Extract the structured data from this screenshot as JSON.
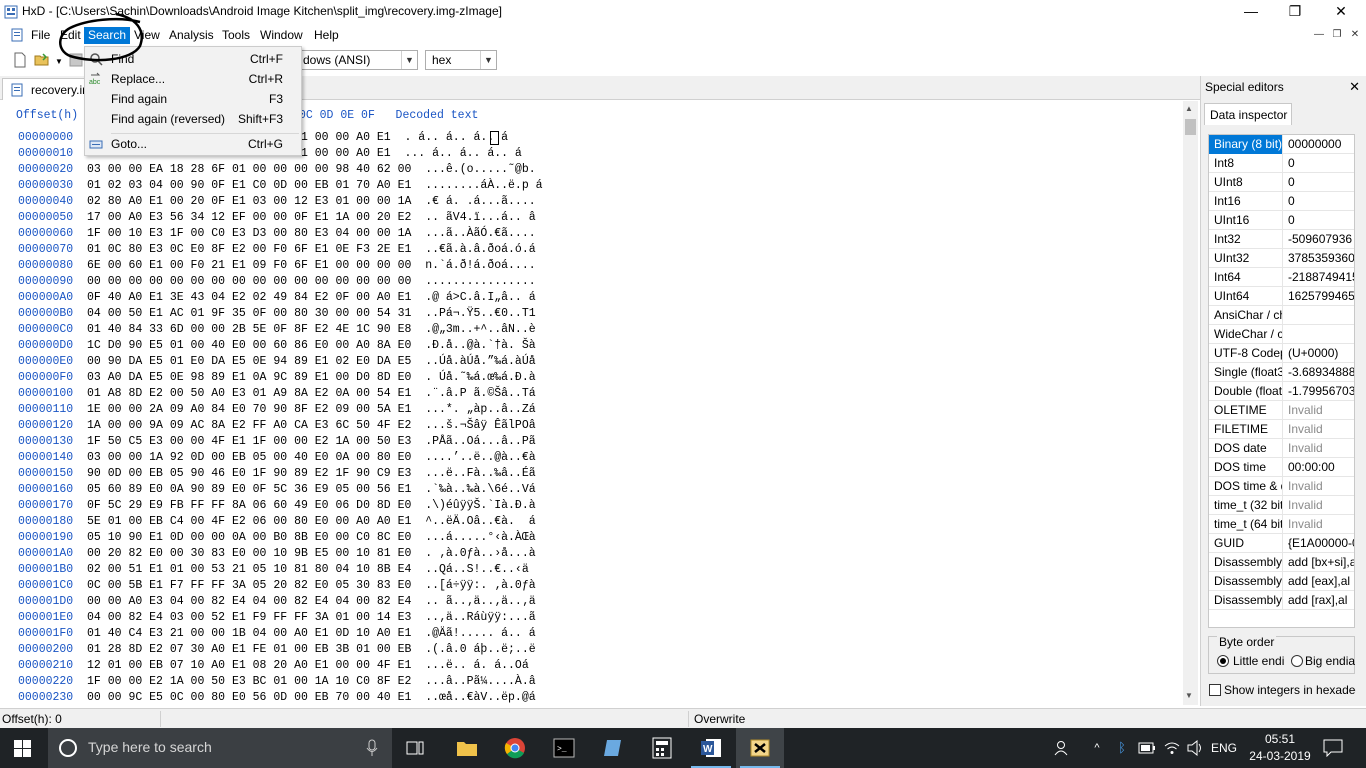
{
  "window": {
    "title": "HxD - [C:\\Users\\Sachin\\Downloads\\Android Image Kitchen\\split_img\\recovery.img-zImage]",
    "minimize": "—",
    "restore": "❐",
    "close": "✕"
  },
  "menu": {
    "file": "File",
    "edit": "Edit",
    "search": "Search",
    "view": "View",
    "analysis": "Analysis",
    "tools": "Tools",
    "window": "Window",
    "help": "Help"
  },
  "search_menu": [
    {
      "label": "Find",
      "shortcut": "Ctrl+F",
      "icon": "find-icon"
    },
    {
      "label": "Replace...",
      "shortcut": "Ctrl+R",
      "icon": "replace-icon"
    },
    {
      "label": "Find again",
      "shortcut": "F3",
      "icon": ""
    },
    {
      "label": "Find again (reversed)",
      "shortcut": "Shift+F3",
      "icon": ""
    },
    {
      "label": "Goto...",
      "shortcut": "Ctrl+G",
      "icon": "goto-icon"
    }
  ],
  "toolbar": {
    "charset": "dows (ANSI)",
    "offset_base": "hex"
  },
  "tab": {
    "label": "recovery.img-zImage"
  },
  "hex": {
    "header": "Offset(h)                       09 0A 0B 0C 0D 0E 0F   Decoded text",
    "rows": [
      {
        "offset": "00000000",
        "bytes": "                        00 A0 E1 00 00 A0 E1",
        "decoded": ". á.. á.. á.. á"
      },
      {
        "offset": "00000010",
        "bytes": "                        00 A0 E1 00 00 A0 E1",
        "decoded": "... á.. á.. á.. á"
      },
      {
        "offset": "00000020",
        "bytes": "03 00 00 EA 18 28 6F 01 00 00 00 00 98 40 62 00",
        "decoded": "...ê.(o.....˜@b."
      },
      {
        "offset": "00000030",
        "bytes": "01 02 03 04 00 90 0F E1 C0 0D 00 EB 01 70 A0 E1",
        "decoded": "........áÀ..ë.p á"
      },
      {
        "offset": "00000040",
        "bytes": "02 80 A0 E1 00 20 0F E1 03 00 12 E3 01 00 00 1A",
        "decoded": ".€ á. .á...ã...."
      },
      {
        "offset": "00000050",
        "bytes": "17 00 A0 E3 56 34 12 EF 00 00 0F E1 1A 00 20 E2",
        "decoded": ".. ãV4.ï...á.. â"
      },
      {
        "offset": "00000060",
        "bytes": "1F 00 10 E3 1F 00 C0 E3 D3 00 80 E3 04 00 00 1A",
        "decoded": "...ã..ÀãÓ.€ã...."
      },
      {
        "offset": "00000070",
        "bytes": "01 0C 80 E3 0C E0 8F E2 00 F0 6F E1 0E F3 2E E1",
        "decoded": "..€ã.à.â.ðoá.ó.á"
      },
      {
        "offset": "00000080",
        "bytes": "6E 00 60 E1 00 F0 21 E1 09 F0 6F E1 00 00 00 00",
        "decoded": "n.`á.ð!á.ðoá...."
      },
      {
        "offset": "00000090",
        "bytes": "00 00 00 00 00 00 00 00 00 00 00 00 00 00 00 00",
        "decoded": "................"
      },
      {
        "offset": "000000A0",
        "bytes": "0F 40 A0 E1 3E 43 04 E2 02 49 84 E2 0F 00 A0 E1",
        "decoded": ".@ á>C.â.I„â.. á"
      },
      {
        "offset": "000000B0",
        "bytes": "04 00 50 E1 AC 01 9F 35 0F 00 80 30 00 00 54 31",
        "decoded": "..Pá¬.Ÿ5..€0..T1"
      },
      {
        "offset": "000000C0",
        "bytes": "01 40 84 33 6D 00 00 2B 5E 0F 8F E2 4E 1C 90 E8",
        "decoded": ".@„3m..+^..âN..è"
      },
      {
        "offset": "000000D0",
        "bytes": "1C D0 90 E5 01 00 40 E0 00 60 86 E0 00 A0 8A E0",
        "decoded": ".Ð.å..@à.`†à. Šà"
      },
      {
        "offset": "000000E0",
        "bytes": "00 90 DA E5 01 E0 DA E5 0E 94 89 E1 02 E0 DA E5",
        "decoded": "..Úå.àÚå.”‰á.àÚå"
      },
      {
        "offset": "000000F0",
        "bytes": "03 A0 DA E5 0E 98 89 E1 0A 9C 89 E1 00 D0 8D E0",
        "decoded": ". Úå.˜‰á.œ‰á.Ð.à"
      },
      {
        "offset": "00000100",
        "bytes": "01 A8 8D E2 00 50 A0 E3 01 A9 8A E2 0A 00 54 E1",
        "decoded": ".¨.â.P ã.©Šâ..Tá"
      },
      {
        "offset": "00000110",
        "bytes": "1E 00 00 2A 09 A0 84 E0 70 90 8F E2 09 00 5A E1",
        "decoded": "...*. „àp..â..Zá"
      },
      {
        "offset": "00000120",
        "bytes": "1A 00 00 9A 09 AC 8A E2 FF A0 CA E3 6C 50 4F E2",
        "decoded": "...š.¬Šâÿ ÊãlPOâ"
      },
      {
        "offset": "00000130",
        "bytes": "1F 50 C5 E3 00 00 4F E1 1F 00 00 E2 1A 00 50 E3",
        "decoded": ".PÅã..Oá...â..Pã"
      },
      {
        "offset": "00000140",
        "bytes": "03 00 00 1A 92 0D 00 EB 05 00 40 E0 0A 00 80 E0",
        "decoded": "....’..ë..@à..€à"
      },
      {
        "offset": "00000150",
        "bytes": "90 0D 00 EB 05 90 46 E0 1F 90 89 E2 1F 90 C9 E3",
        "decoded": "...ë..Fà..‰â..Éã"
      },
      {
        "offset": "00000160",
        "bytes": "05 60 89 E0 0A 90 89 E0 0F 5C 36 E9 05 00 56 E1",
        "decoded": ".`‰à..‰à.\\6é..Vá"
      },
      {
        "offset": "00000170",
        "bytes": "0F 5C 29 E9 FB FF FF 8A 06 60 49 E0 06 D0 8D E0",
        "decoded": ".\\)éûÿÿŠ.`Ià.Ð.à"
      },
      {
        "offset": "00000180",
        "bytes": "5E 01 00 EB C4 00 4F E2 06 00 80 E0 00 A0 A0 E1",
        "decoded": "^..ëÄ.Oâ..€à.  á"
      },
      {
        "offset": "00000190",
        "bytes": "05 10 90 E1 0D 00 00 0A 00 B0 8B E0 00 C0 8C E0",
        "decoded": "...á.....°‹à.ÀŒà"
      },
      {
        "offset": "000001A0",
        "bytes": "00 20 82 E0 00 30 83 E0 00 10 9B E5 00 10 81 E0",
        "decoded": ". ‚à.0ƒà..›å...à"
      },
      {
        "offset": "000001B0",
        "bytes": "02 00 51 E1 01 00 53 21 05 10 81 80 04 10 8B E4",
        "decoded": "..Qá..S!..€..‹ä"
      },
      {
        "offset": "000001C0",
        "bytes": "0C 00 5B E1 F7 FF FF 3A 05 20 82 E0 05 30 83 E0",
        "decoded": "..[á÷ÿÿ:. ‚à.0ƒà"
      },
      {
        "offset": "000001D0",
        "bytes": "00 00 A0 E3 04 00 82 E4 04 00 82 E4 04 00 82 E4",
        "decoded": ".. ã..‚ä..‚ä..‚ä"
      },
      {
        "offset": "000001E0",
        "bytes": "04 00 82 E4 03 00 52 E1 F9 FF FF 3A 01 00 14 E3",
        "decoded": "..‚ä..Ráùÿÿ:...ã"
      },
      {
        "offset": "000001F0",
        "bytes": "01 40 C4 E3 21 00 00 1B 04 00 A0 E1 0D 10 A0 E1",
        "decoded": ".@Äã!..... á.. á"
      },
      {
        "offset": "00000200",
        "bytes": "01 28 8D E2 07 30 A0 E1 FE 01 00 EB 3B 01 00 EB",
        "decoded": ".(.â.0 áþ..ë;..ë"
      },
      {
        "offset": "00000210",
        "bytes": "12 01 00 EB 07 10 A0 E1 08 20 A0 E1 00 00 4F E1",
        "decoded": "...ë.. á. á..Oá"
      },
      {
        "offset": "00000220",
        "bytes": "1F 00 00 E2 1A 00 50 E3 BC 01 00 1A 10 C0 8F E2",
        "decoded": "...â..Pã¼....À.â"
      },
      {
        "offset": "00000230",
        "bytes": "00 00 9C E5 0C 00 80 E0 56 0D 00 EB 70 00 40 E1",
        "decoded": "..œå..€àV..ëp.@á"
      }
    ]
  },
  "special_editors": {
    "title": "Special editors",
    "close": "✕",
    "tab": "Data inspector",
    "rows": [
      {
        "k": "Binary (8 bit)",
        "v": "00000000",
        "sel": true
      },
      {
        "k": "Int8",
        "v": "0"
      },
      {
        "k": "UInt8",
        "v": "0"
      },
      {
        "k": "Int16",
        "v": "0"
      },
      {
        "k": "UInt16",
        "v": "0"
      },
      {
        "k": "Int32",
        "v": "-509607936"
      },
      {
        "k": "UInt32",
        "v": "3785359360"
      },
      {
        "k": "Int64",
        "v": "-2188749415"
      },
      {
        "k": "UInt64",
        "v": "16257994658"
      },
      {
        "k": "AnsiChar / ch",
        "v": ""
      },
      {
        "k": "WideChar / c",
        "v": ""
      },
      {
        "k": "UTF-8 Codep",
        "v": " (U+0000)"
      },
      {
        "k": "Single (float3",
        "v": "-3.6893488814"
      },
      {
        "k": "Double (float",
        "v": "-1.799567030"
      },
      {
        "k": "OLETIME",
        "v": "Invalid",
        "gray": true
      },
      {
        "k": "FILETIME",
        "v": "Invalid",
        "gray": true
      },
      {
        "k": "DOS date",
        "v": "Invalid",
        "gray": true
      },
      {
        "k": "DOS time",
        "v": "00:00:00"
      },
      {
        "k": "DOS time & d",
        "v": "Invalid",
        "gray": true
      },
      {
        "k": "time_t (32 bit",
        "v": "Invalid",
        "gray": true
      },
      {
        "k": "time_t (64 bit",
        "v": "Invalid",
        "gray": true
      },
      {
        "k": "GUID",
        "v": "{E1A00000-0"
      },
      {
        "k": "Disassembly",
        "v": "add [bx+si],a"
      },
      {
        "k": "Disassembly",
        "v": "add [eax],al"
      },
      {
        "k": "Disassembly",
        "v": "add [rax],al"
      }
    ],
    "byte_order": "Byte order",
    "little_endian": "Little endi",
    "big_endian": "Big endiar",
    "show_hex": "Show integers in hexadec"
  },
  "status": {
    "offset": "Offset(h): 0",
    "mode": "Overwrite"
  },
  "taskbar": {
    "search_placeholder": "Type here to search",
    "language": "ENG",
    "time": "05:51",
    "date": "24-03-2019"
  }
}
